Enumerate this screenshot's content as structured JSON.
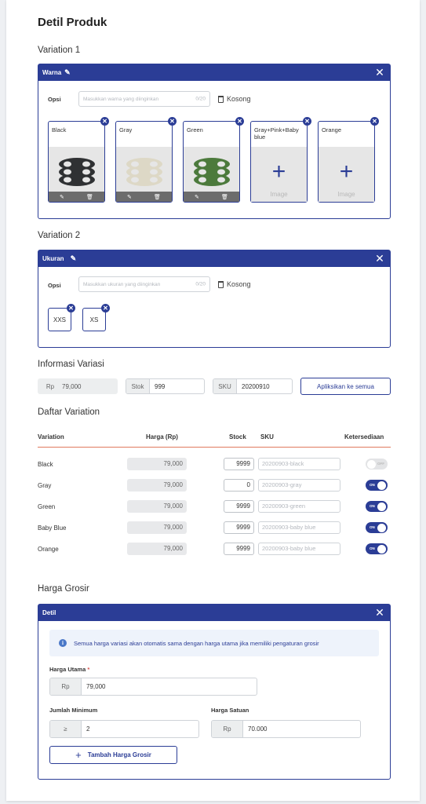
{
  "page": {
    "title": "Detil Produk"
  },
  "variation1": {
    "heading": "Variation 1",
    "panel_title": "Warna",
    "opsi_label": "Opsi",
    "input_placeholder": "Masukkan warna yang diinginkan",
    "char_count": "0/20",
    "clear_label": "Kosong",
    "options": [
      {
        "name": "Black",
        "color": "#2f3133",
        "has_image": true
      },
      {
        "name": "Gray",
        "color": "#ddd8c6",
        "has_image": true
      },
      {
        "name": "Green",
        "color": "#4c7a3c",
        "has_image": true
      },
      {
        "name": "Gray+Pink+Baby blue",
        "has_image": false,
        "image_text": "Image"
      },
      {
        "name": "Orange",
        "has_image": false,
        "image_text": "Image"
      }
    ]
  },
  "variation2": {
    "heading": "Variation 2",
    "panel_title": "Ukuran",
    "opsi_label": "Opsi",
    "input_placeholder": "Masukkan ukuran yang diinginkan",
    "char_count": "0/20",
    "clear_label": "Kosong",
    "options": [
      "XXS",
      "XS"
    ]
  },
  "info_variasi": {
    "heading": "Informasi Variasi",
    "price_prefix": "Rp",
    "price_value": "79,000",
    "stock_prefix": "Stok",
    "stock_value": "999",
    "sku_prefix": "SKU",
    "sku_value": "20200910",
    "apply_button": "Apliksikan ke semua"
  },
  "daftar": {
    "heading": "Daftar Variation",
    "columns": {
      "variation": "Variation",
      "harga": "Harga (Rp)",
      "stock": "Stock",
      "sku": "SKU",
      "ketersediaan": "Ketersediaan"
    },
    "rows": [
      {
        "variation": "Black",
        "harga": "79,000",
        "stock": "9999",
        "sku": "20200903-black",
        "available": false,
        "toggle_text": "OFF"
      },
      {
        "variation": "Gray",
        "harga": "79,000",
        "stock": "0",
        "sku": "20200903-gray",
        "available": true,
        "toggle_text": "ON"
      },
      {
        "variation": "Green",
        "harga": "79,000",
        "stock": "9999",
        "sku": "20200903-green",
        "available": true,
        "toggle_text": "ON"
      },
      {
        "variation": "Baby Blue",
        "harga": "79,000",
        "stock": "9999",
        "sku": "20200903-baby blue",
        "available": true,
        "toggle_text": "ON"
      },
      {
        "variation": "Orange",
        "harga": "79,000",
        "stock": "9999",
        "sku": "20200903-baby blue",
        "available": true,
        "toggle_text": "ON"
      }
    ]
  },
  "grosir": {
    "heading": "Harga Grosir",
    "panel_title": "Detil",
    "info_text": "Semua harga variasi akan otomatis sama dengan harga utama jika memiliki pengaturan grosir",
    "harga_utama_label": "Harga Utama",
    "required_mark": "*",
    "harga_utama_prefix": "Rp",
    "harga_utama_value": "79,000",
    "jumlah_min_label": "Jumlah Minimum",
    "jumlah_min_prefix": "≥",
    "jumlah_min_value": "2",
    "harga_satuan_label": "Harga Satuan",
    "harga_satuan_prefix": "Rp",
    "harga_satuan_value": "70.000",
    "add_button": "Tambah Harga Grosir"
  },
  "colors": {
    "primary": "#2b3d96",
    "divider": "#e07a5f"
  }
}
